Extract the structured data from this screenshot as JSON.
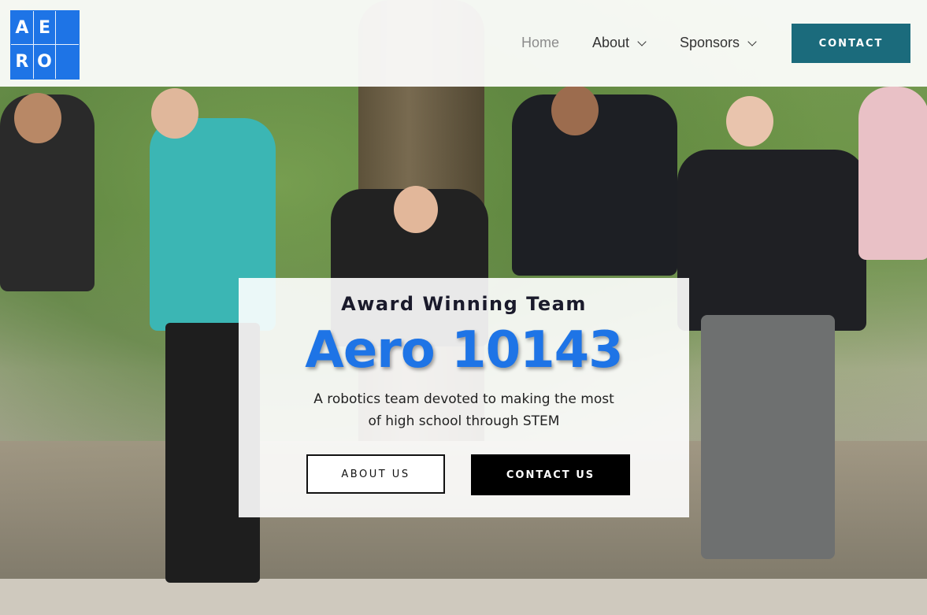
{
  "header": {
    "logo_letters": [
      "A",
      "E",
      "",
      "R",
      "O",
      ""
    ],
    "nav": {
      "home": "Home",
      "about": "About",
      "sponsors": "Sponsors"
    },
    "contact_label": "CONTACT"
  },
  "hero": {
    "kicker": "Award Winning Team",
    "headline": "Aero 10143",
    "description_line1": "A robotics team devoted to making the most",
    "description_line2": "of high school through STEM",
    "about_button": "ABOUT US",
    "contact_button": "CONTACT US"
  },
  "colors": {
    "brand_blue": "#1e74e6",
    "teal_button": "#1b6b7c",
    "black_button": "#000000"
  },
  "icons": {
    "about_dropdown": "chevron-down-icon",
    "sponsors_dropdown": "chevron-down-icon"
  }
}
